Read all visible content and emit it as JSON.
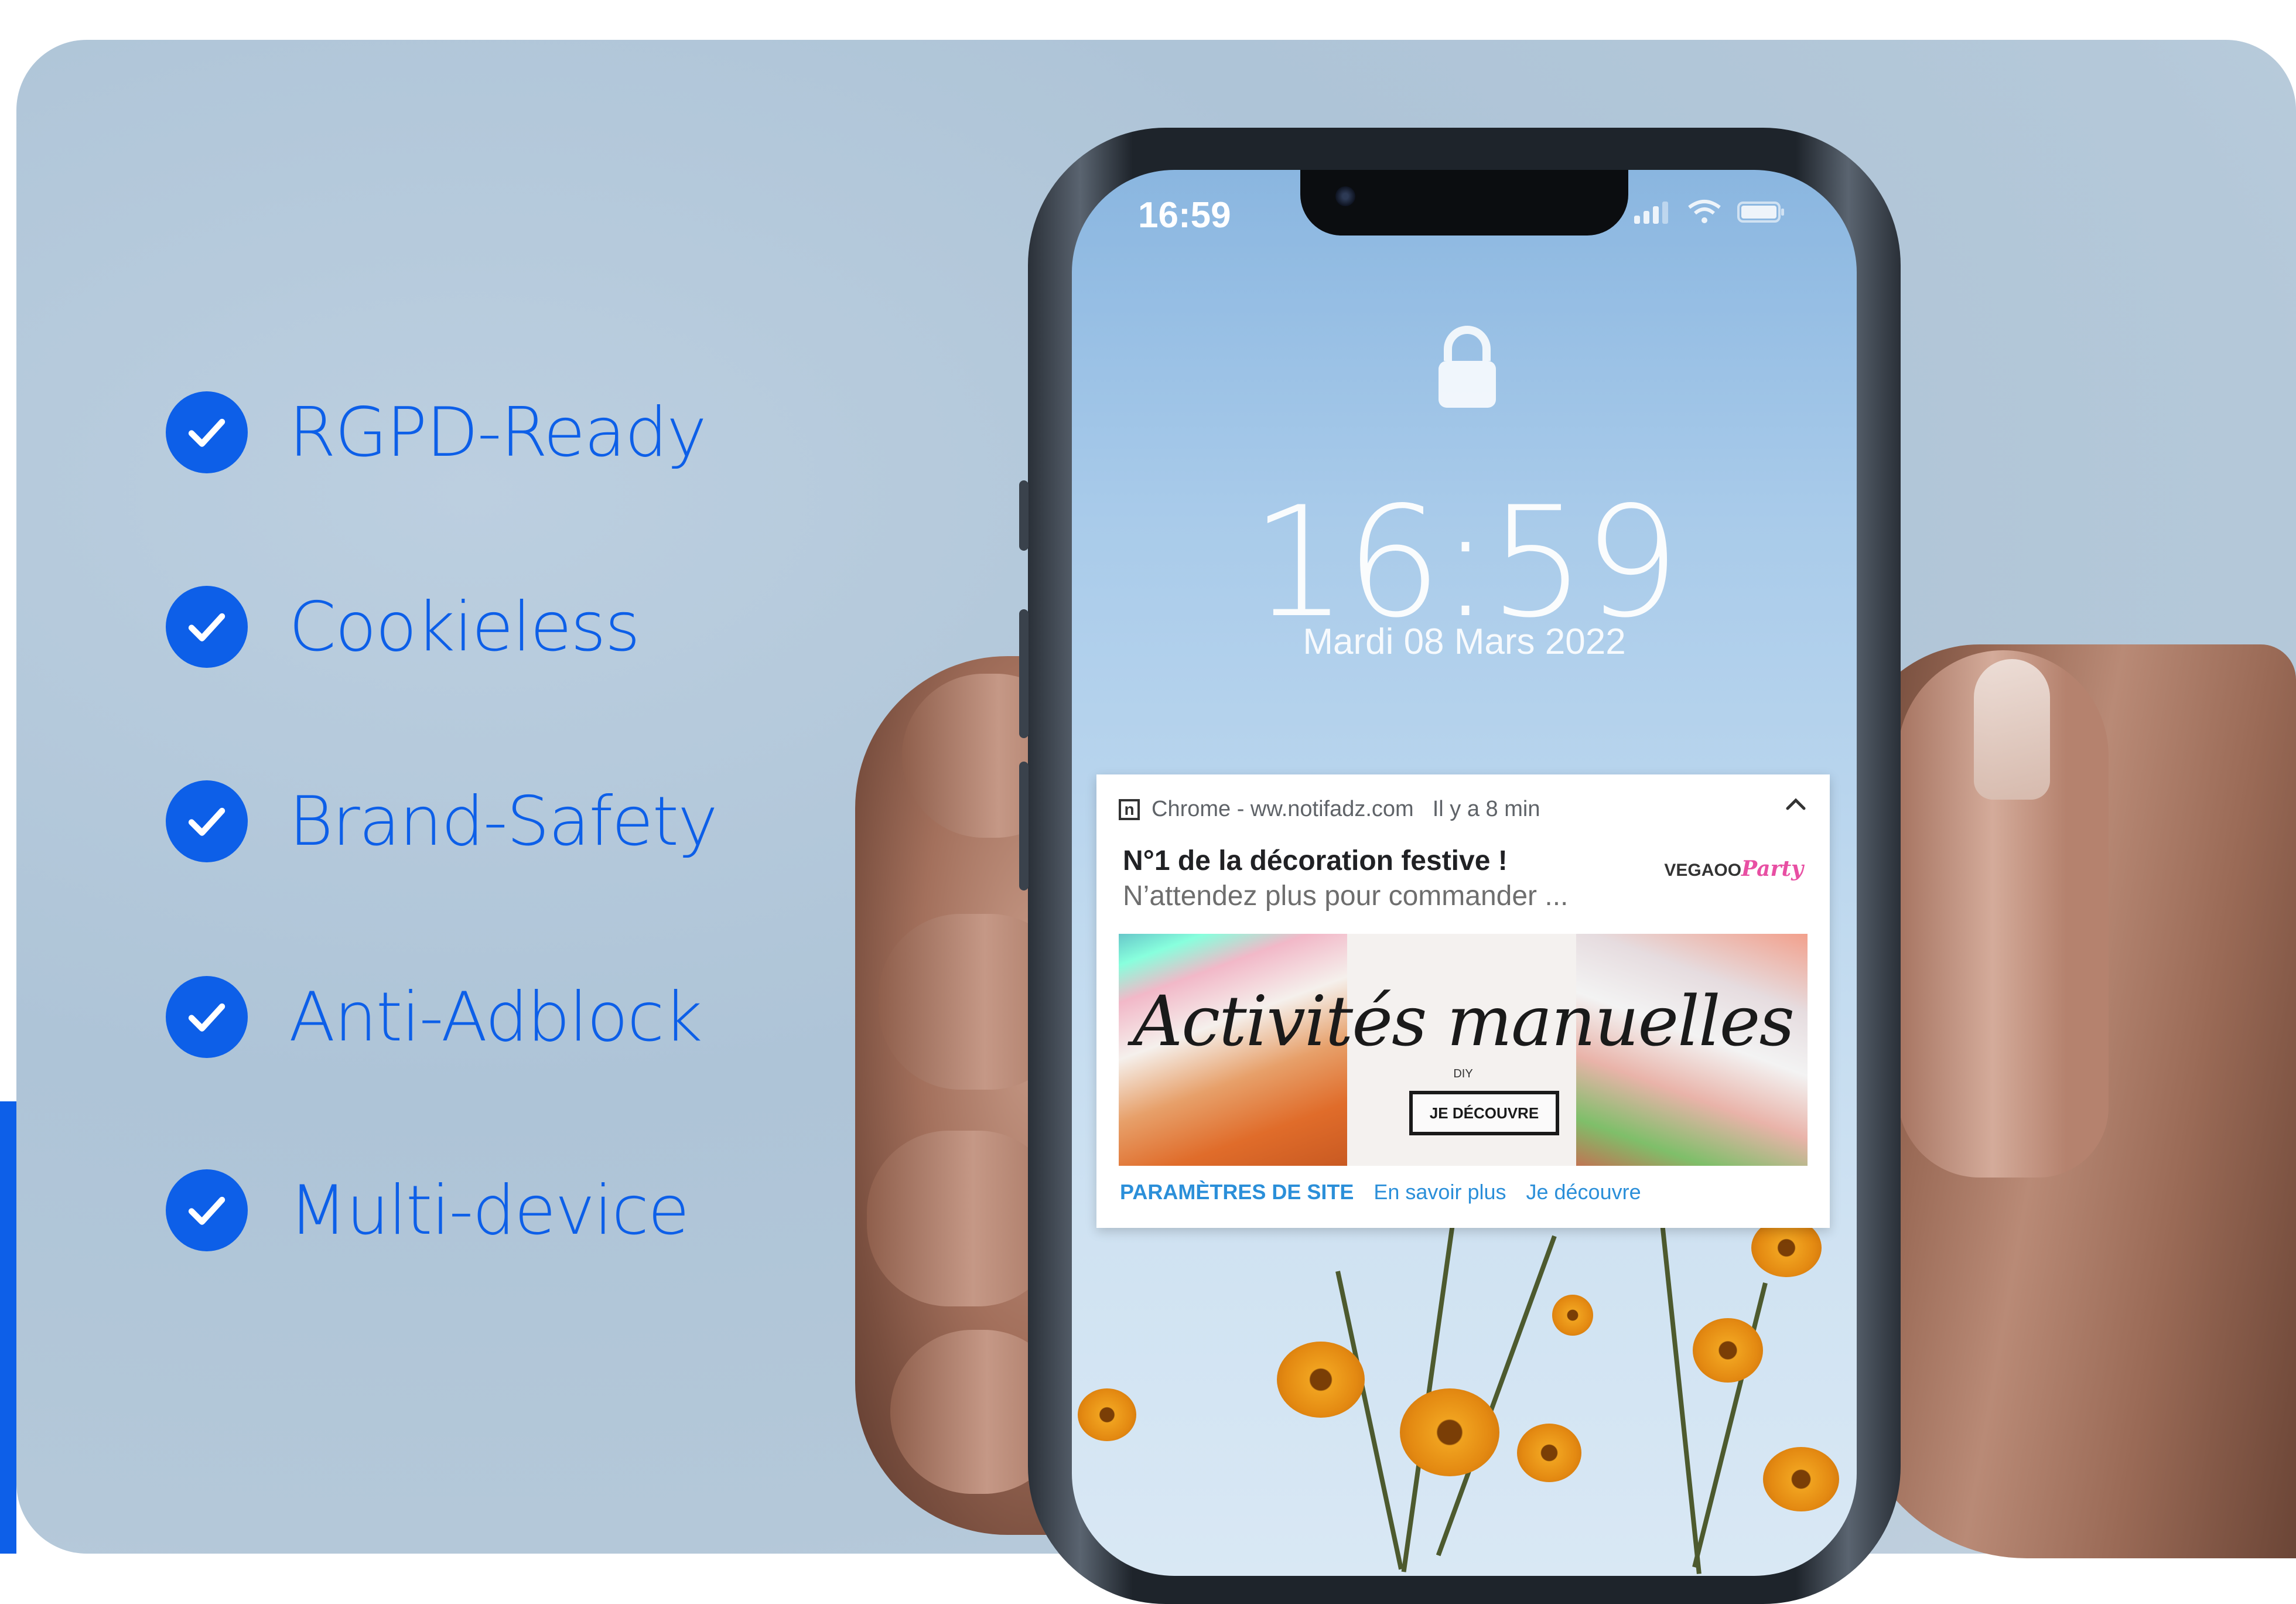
{
  "colors": {
    "accent": "#0d5fe8",
    "link": "#2b8fd9"
  },
  "features": [
    {
      "label": "RGPD-Ready",
      "icon": "check-circle-icon"
    },
    {
      "label": "Cookieless",
      "icon": "check-circle-icon"
    },
    {
      "label": "Brand-Safety",
      "icon": "check-circle-icon"
    },
    {
      "label": "Anti-Adblock",
      "icon": "check-circle-icon"
    },
    {
      "label": "Multi-device",
      "icon": "check-circle-icon"
    }
  ],
  "phone": {
    "status_time": "16:59",
    "lock_time": "16:59",
    "lock_date": "Mardi 08 Mars 2022"
  },
  "notification": {
    "app_icon_letter": "n",
    "source": "Chrome - ww.notifadz.com",
    "time_ago": "Il y a 8 min",
    "title": "N°1 de la décoration festive !",
    "body": "N’attendez plus pour commander ...",
    "brand_logo_prefix": "VEGAOO",
    "brand_logo_suffix": "Party",
    "banner": {
      "title": "Activités manuelles",
      "subtitle": "DIY",
      "button": "JE DÉCOUVRE"
    },
    "actions": [
      "PARAMÈTRES DE SITE",
      "En savoir plus",
      "Je découvre"
    ]
  }
}
